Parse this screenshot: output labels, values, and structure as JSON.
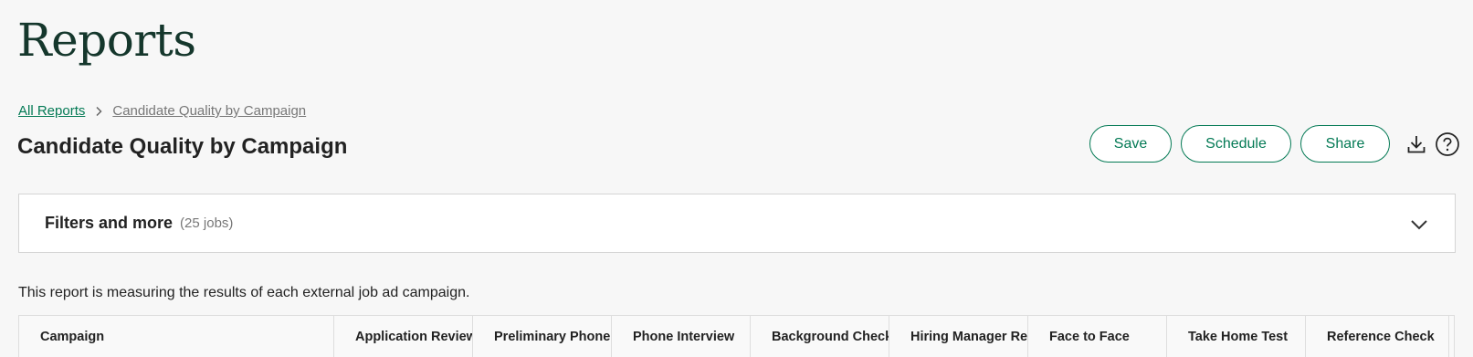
{
  "app": {
    "title": "Reports"
  },
  "breadcrumb": {
    "items": [
      "All Reports",
      "Candidate Quality by Campaign"
    ],
    "separator_icon": "chevron-right-icon"
  },
  "page": {
    "title": "Candidate Quality by Campaign"
  },
  "toolbar": {
    "save_label": "Save",
    "schedule_label": "Schedule",
    "share_label": "Share",
    "download_icon": "download-icon",
    "help_icon": "help-circle-icon"
  },
  "filters": {
    "title": "Filters and more",
    "count": "(25 jobs)",
    "expand_icon": "chevron-down-icon"
  },
  "report": {
    "description": "This report is measuring the results of each external job ad campaign."
  },
  "table": {
    "columns": [
      "Campaign",
      "Application Review",
      "Preliminary Phone Screen",
      "Phone Interview",
      "Background Check",
      "Hiring Manager Review",
      "Face to Face",
      "Take Home Test",
      "Reference Check"
    ]
  },
  "colors": {
    "accent": "#047a55",
    "title": "#15372c",
    "background": "#f7f7f7"
  }
}
